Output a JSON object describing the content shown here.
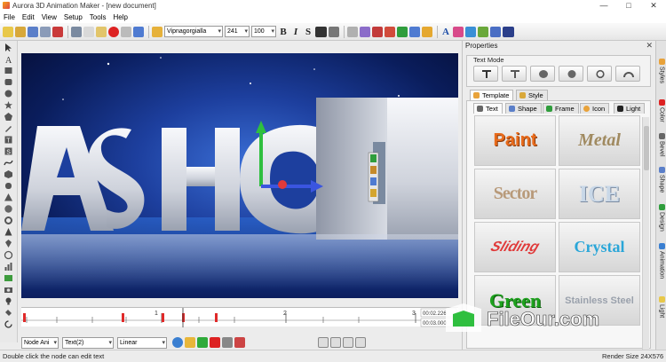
{
  "window": {
    "title": "Aurora 3D Animation Maker - [new document]",
    "min_glyph": "—",
    "max_glyph": "□",
    "close_glyph": "✕"
  },
  "menu": {
    "items": [
      "File",
      "Edit",
      "View",
      "Setup",
      "Tools",
      "Help"
    ]
  },
  "toolbar": {
    "font_family": "Vipnagorgialla",
    "font_size": "241",
    "scale": "100",
    "bold_label": "B",
    "italic_label": "I",
    "shadow_label": "S",
    "text_a_label": "A"
  },
  "canvas": {
    "scene_text": "ASHOK"
  },
  "timeline": {
    "tick_labels": [
      "1",
      "2",
      "3"
    ],
    "time_readout": "00:02.226",
    "time_readout2": "00:03.000"
  },
  "bottombar": {
    "node_select": "Node Ani",
    "text_select": "Text(2)",
    "interp_select": "Linear"
  },
  "status": {
    "hint": "Double click the node can edit text",
    "render_size": "Render Size 24X576"
  },
  "properties": {
    "title": "Properties",
    "text_mode_label": "Text Mode",
    "tabs_top": [
      "Template",
      "Style"
    ],
    "tabs_sub": [
      "Text",
      "Shape",
      "Frame",
      "Icon",
      "Light"
    ],
    "templates": [
      "Paint",
      "Metal",
      "Sector",
      "ICE",
      "Sliding",
      "Crystal",
      "Green",
      "Stainless Steel"
    ]
  },
  "side_tabs": [
    "Styles",
    "Color",
    "Bevel",
    "Shape",
    "Design",
    "Animation",
    "Light"
  ],
  "watermark": {
    "text": "FileOur.com"
  },
  "colors": {
    "accent_blue": "#1d3f9e",
    "paint_orange": "#e86b1c",
    "crystal_blue": "#2aa6d8",
    "green_text": "#1ea21e"
  }
}
